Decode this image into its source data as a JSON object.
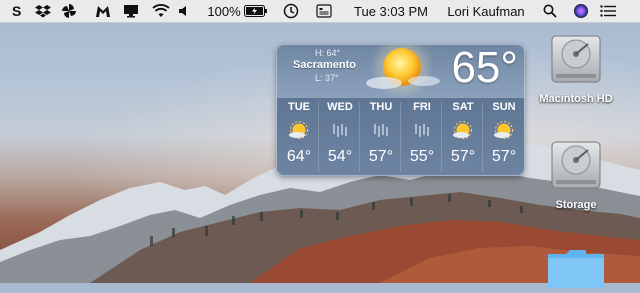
{
  "menubar": {
    "battery": "100%",
    "clock": "Tue 3:03 PM",
    "user": "Lori Kaufman"
  },
  "weather": {
    "city": "Sacramento",
    "high": "H: 64°",
    "low": "L: 37°",
    "current_temp": "65°",
    "forecast": [
      {
        "day": "TUE",
        "temp": "64°",
        "icon": "partly-cloudy-icon"
      },
      {
        "day": "WED",
        "temp": "54°",
        "icon": "rain-icon"
      },
      {
        "day": "THU",
        "temp": "57°",
        "icon": "rain-icon"
      },
      {
        "day": "FRI",
        "temp": "55°",
        "icon": "rain-icon"
      },
      {
        "day": "SAT",
        "temp": "57°",
        "icon": "partly-cloudy-icon"
      },
      {
        "day": "SUN",
        "temp": "57°",
        "icon": "partly-cloudy-icon"
      }
    ]
  },
  "desktop": {
    "icons": [
      {
        "label": "Macintosh HD",
        "icon": "hard-drive-icon"
      },
      {
        "label": "Storage",
        "icon": "hard-drive-icon"
      },
      {
        "label": "",
        "icon": "folder-icon"
      }
    ]
  }
}
